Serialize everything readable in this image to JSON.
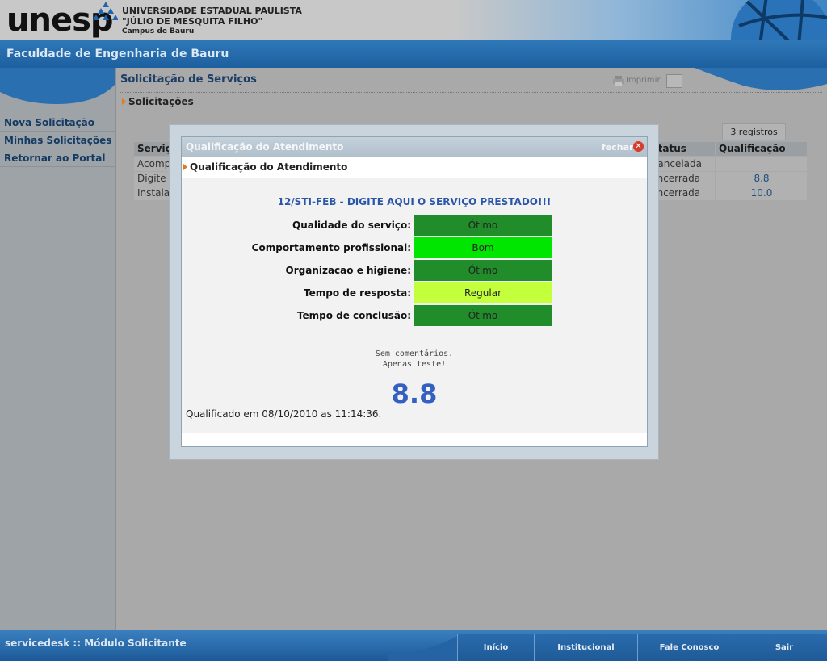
{
  "header": {
    "logo_text": "unesp",
    "university_line1": "UNIVERSIDADE ESTADUAL PAULISTA",
    "university_line2": "\"JÚLIO DE MESQUITA FILHO\"",
    "university_line3": "Campus de Bauru",
    "faculty": "Faculdade de Engenharia de Bauru"
  },
  "sidebar": {
    "items": [
      {
        "label": "Nova Solicitação"
      },
      {
        "label": "Minhas Solicitações"
      },
      {
        "label": "Retornar ao Portal"
      }
    ]
  },
  "page": {
    "title": "Solicitação de Serviços",
    "print_label": "Imprimir",
    "section": "Solicitações",
    "records_count": "3 registros"
  },
  "table": {
    "headers": {
      "service": "Serviç",
      "status": "Status",
      "rating": "Qualificação"
    },
    "rows": [
      {
        "service": "Acompan",
        "status": "Cancelada",
        "rating": ""
      },
      {
        "service": "Digite a",
        "status": "Encerrada",
        "rating": "8.8"
      },
      {
        "service": "Instalaçã",
        "status": "Encerrada",
        "rating": "10.0"
      }
    ]
  },
  "modal": {
    "title": "Qualificação do Atendimento",
    "close_label": "fechar",
    "subtitle": "Qualificação do Atendimento",
    "service_title": "12/STI-FEB - DIGITE AQUI O SERVIÇO PRESTADO!!!",
    "criteria": [
      {
        "label": "Qualidade do serviço:",
        "value": "Ótimo",
        "color": "#218c2a"
      },
      {
        "label": "Comportamento profissional:",
        "value": "Bom",
        "color": "#00e600"
      },
      {
        "label": "Organizacao e higiene:",
        "value": "Ótimo",
        "color": "#218c2a"
      },
      {
        "label": "Tempo de resposta:",
        "value": "Regular",
        "color": "#c4ff3c"
      },
      {
        "label": "Tempo de conclusão:",
        "value": "Ótimo",
        "color": "#218c2a"
      }
    ],
    "comment_line1": "Sem comentários.",
    "comment_line2": "Apenas teste!",
    "score": "8.8",
    "rated_at": "Qualificado em 08/10/2010 as 11:14:36."
  },
  "footer": {
    "title": "servicedesk :: Módulo Solicitante",
    "nav": [
      {
        "label": "Início"
      },
      {
        "label": "Institucional"
      },
      {
        "label": "Fale Conosco"
      },
      {
        "label": "Sair"
      }
    ]
  },
  "colors": {
    "brand_blue": "#1d5f9f",
    "link_blue": "#123a62",
    "score_blue": "#3460c2"
  }
}
